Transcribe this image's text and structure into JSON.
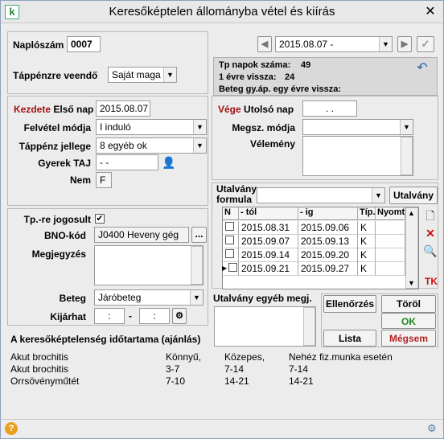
{
  "window": {
    "title": "Keresőképtelen állományba vétel és kiírás"
  },
  "left": {
    "naplo_label": "Naplószám",
    "naplo_value": "0007",
    "tappenz_label": "Táppénzre veendő",
    "tappenz_value": "Saját maga",
    "kezdete_label": "Kezdete",
    "elso_nap_label": "Első nap",
    "elso_nap_value": "2015.08.07",
    "felvetel_label": "Felvétel módja",
    "felvetel_value": "I  induló",
    "jelleg_label": "Táppénz jellege",
    "jelleg_value": "8 egyéb ok",
    "taj_label": "Gyerek TAJ",
    "taj_value": "-  -",
    "nem_label": "Nem",
    "nem_value": "F",
    "jogosult_label": "Tp.-re jogosult",
    "jogosult_checked": "✔",
    "bno_label": "BNO-kód",
    "bno_value": "J0400 Heveny gég",
    "bno_button": "...",
    "megj_label": "Megjegyzés",
    "beteg_label": "Beteg",
    "beteg_value": "Járóbeteg",
    "kijarhat_label": "Kijárhat",
    "kijarhat_from": ":",
    "kijarhat_dash": "-",
    "kijarhat_to": ":"
  },
  "nav": {
    "date_select": "2015.08.07 -"
  },
  "info": {
    "tp_napok_label": "Tp napok száma:",
    "tp_napok_value": "49",
    "egy_ev_label": "1 évre vissza:",
    "egy_ev_value": "24",
    "beteg_gyap_label": "Beteg gy.áp. egy évre vissza:"
  },
  "right": {
    "vege_label": "Vége",
    "utolso_label": "Utolsó nap",
    "utolso_value": ". .",
    "megsz_label": "Megsz. módja",
    "velemeny_label": "Vélemény",
    "utalvany_formula_label": "Utalvány formula",
    "utalvany_button": "Utalvány",
    "egyeb_megj_label": "Utalvány egyéb megj.",
    "tk_label": "TK"
  },
  "grid": {
    "headers": [
      "N",
      "- tól",
      "- ig",
      "Típ.",
      "Nyomt"
    ],
    "rows": [
      {
        "tol": "2015.08.31",
        "ig": "2015.09.06",
        "tip": "K"
      },
      {
        "tol": "2015.09.07",
        "ig": "2015.09.13",
        "tip": "K"
      },
      {
        "tol": "2015.09.14",
        "ig": "2015.09.20",
        "tip": "K"
      },
      {
        "tol": "2015.09.21",
        "ig": "2015.09.27",
        "tip": "K"
      }
    ]
  },
  "buttons": {
    "ellenorzes": "Ellenőrzés",
    "torol": "Töröl",
    "ok": "OK",
    "lista": "Lista",
    "megsem": "Mégsem"
  },
  "colors": {
    "ok_green": "#1a8a1a",
    "megsem_red": "#b22222",
    "kezdete_red": "#a01010"
  },
  "bottom": {
    "heading": "A keresőképtelenség időtartama (ajánlás)",
    "col_headers": [
      "Könnyű,",
      "Közepes,",
      "Nehéz fiz.munka esetén"
    ],
    "rows": [
      {
        "name": "Akut brochitis",
        "a": "",
        "b": "",
        "c": ""
      },
      {
        "name": "Akut brochitis",
        "a": "3-7",
        "b": "7-14",
        "c": "7-14"
      },
      {
        "name": "Orrsövényműtét",
        "a": "7-10",
        "b": "14-21",
        "c": "14-21"
      }
    ],
    "first_row_label": "Akut brochitis"
  }
}
